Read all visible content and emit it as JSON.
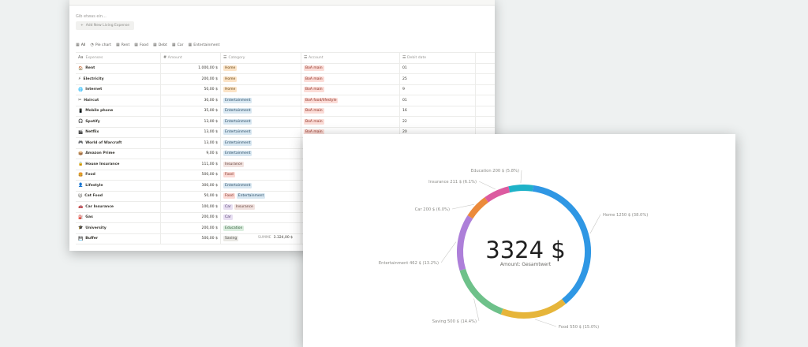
{
  "table": {
    "quick_add_placeholder": "Gib etwas ein...",
    "add_button": "Add New Living Expense",
    "views": [
      {
        "icon": "table-icon",
        "label": "All"
      },
      {
        "icon": "pie-chart-icon",
        "label": "Pie chart"
      },
      {
        "icon": "table-icon",
        "label": "Rent"
      },
      {
        "icon": "table-icon",
        "label": "Food"
      },
      {
        "icon": "table-icon",
        "label": "Debt"
      },
      {
        "icon": "table-icon",
        "label": "Car"
      },
      {
        "icon": "table-icon",
        "label": "Entertainment"
      }
    ],
    "headers": {
      "name": "Expenses",
      "amount": "Amount",
      "category": "Category",
      "account": "Account",
      "date": "Debit date"
    },
    "rows": [
      {
        "name": "Rent",
        "amount": "1.000,00 $",
        "tags": [
          {
            "label": "Home",
            "cls": "t-home"
          }
        ],
        "account": "BoA main",
        "date": "01"
      },
      {
        "name": "Electricity",
        "amount": "200,00 $",
        "tags": [
          {
            "label": "Home",
            "cls": "t-home"
          }
        ],
        "account": "BoA main",
        "date": "25"
      },
      {
        "name": "Internet",
        "amount": "50,00 $",
        "tags": [
          {
            "label": "Home",
            "cls": "t-home"
          }
        ],
        "account": "BoA main",
        "date": "9"
      },
      {
        "name": "Haircut",
        "amount": "30,00 $",
        "tags": [
          {
            "label": "Entertainment",
            "cls": "t-ent"
          }
        ],
        "account": "BoA food/lifestyle",
        "date": "01"
      },
      {
        "name": "Mobile phone",
        "amount": "35,00 $",
        "tags": [
          {
            "label": "Entertainment",
            "cls": "t-ent"
          }
        ],
        "account": "BoA main",
        "date": "16"
      },
      {
        "name": "Spotify",
        "amount": "13,00 $",
        "tags": [
          {
            "label": "Entertainment",
            "cls": "t-ent"
          }
        ],
        "account": "BoA main",
        "date": "22"
      },
      {
        "name": "Netflix",
        "amount": "13,00 $",
        "tags": [
          {
            "label": "Entertainment",
            "cls": "t-ent"
          }
        ],
        "account": "BoA main",
        "date": "20"
      },
      {
        "name": "World of Warcraft",
        "amount": "13,00 $",
        "tags": [
          {
            "label": "Entertainment",
            "cls": "t-ent"
          }
        ],
        "account": "",
        "date": ""
      },
      {
        "name": "Amazon Prime",
        "amount": "9,00 $",
        "tags": [
          {
            "label": "Entertainment",
            "cls": "t-ent"
          }
        ],
        "account": "",
        "date": ""
      },
      {
        "name": "House Insurance",
        "amount": "111,00 $",
        "tags": [
          {
            "label": "Insurance",
            "cls": "t-ins"
          }
        ],
        "account": "",
        "date": ""
      },
      {
        "name": "Food",
        "amount": "500,00 $",
        "tags": [
          {
            "label": "Food",
            "cls": "t-food"
          }
        ],
        "account": "",
        "date": ""
      },
      {
        "name": "Lifestyle",
        "amount": "300,00 $",
        "tags": [
          {
            "label": "Entertainment",
            "cls": "t-ent"
          }
        ],
        "account": "",
        "date": ""
      },
      {
        "name": "Cat Food",
        "amount": "50,00 $",
        "tags": [
          {
            "label": "Food",
            "cls": "t-food"
          },
          {
            "label": "Entertainment",
            "cls": "t-ent"
          }
        ],
        "account": "",
        "date": ""
      },
      {
        "name": "Car Insurance",
        "amount": "100,00 $",
        "tags": [
          {
            "label": "Car",
            "cls": "t-car"
          },
          {
            "label": "Insurance",
            "cls": "t-ins"
          }
        ],
        "account": "",
        "date": ""
      },
      {
        "name": "Gas",
        "amount": "200,00 $",
        "tags": [
          {
            "label": "Car",
            "cls": "t-car"
          }
        ],
        "account": "",
        "date": ""
      },
      {
        "name": "University",
        "amount": "200,00 $",
        "tags": [
          {
            "label": "Education",
            "cls": "t-edu"
          }
        ],
        "account": "",
        "date": ""
      },
      {
        "name": "Buffer",
        "amount": "500,00 $",
        "tags": [
          {
            "label": "Saving",
            "cls": "t-sav"
          }
        ],
        "account": "",
        "date": ""
      }
    ],
    "summary_label": "SUMME",
    "summary_value": "3.324,00 $"
  },
  "chart_data": {
    "type": "pie",
    "total_label": "3324 $",
    "total_caption": "Amount: Gesamtwert",
    "slices": [
      {
        "name": "Home",
        "value": 1250,
        "pct": "38.0%",
        "label": "Home 1250 $ (38.0%)",
        "color": "#2f97e4"
      },
      {
        "name": "Food",
        "value": 550,
        "pct": "15.0%",
        "label": "Food 550 $ (15.0%)",
        "color": "#e6b53a"
      },
      {
        "name": "Saving",
        "value": 500,
        "pct": "14.4%",
        "label": "Saving 500 $ (14.4%)",
        "color": "#6ec18a"
      },
      {
        "name": "Entertainment",
        "value": 462,
        "pct": "13.2%",
        "label": "Entertainment 462 $ (13.2%)",
        "color": "#ad7fd9"
      },
      {
        "name": "Car",
        "value": 200,
        "pct": "6.0%",
        "label": "Car 200 $ (6.0%)",
        "color": "#eb8a3b"
      },
      {
        "name": "Insurance",
        "value": 211,
        "pct": "6.1%",
        "label": "Insurance 211 $ (6.1%)",
        "color": "#dc5ba0"
      },
      {
        "name": "Education",
        "value": 200,
        "pct": "5.8%",
        "label": "Education 200 $ (5.8%)",
        "color": "#1eb2c8"
      }
    ]
  }
}
